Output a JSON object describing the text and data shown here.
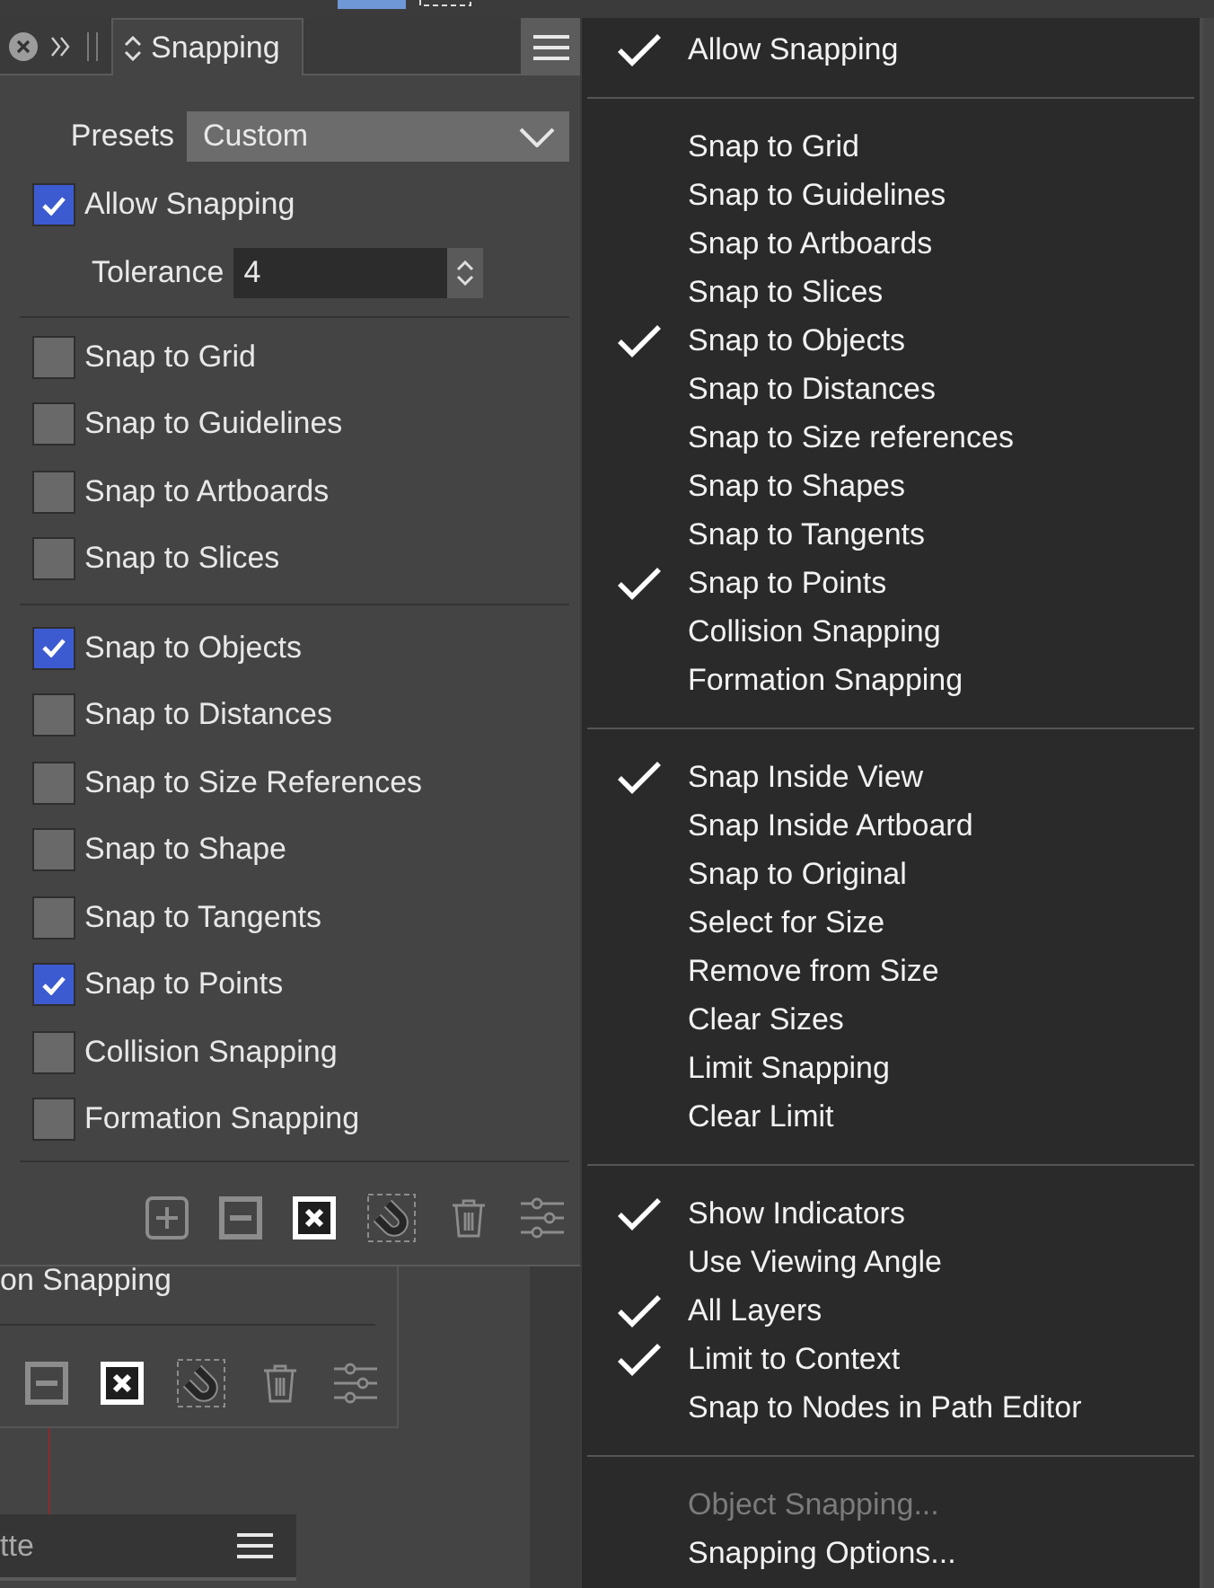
{
  "panel": {
    "tabs": [
      {
        "label": "Snapping",
        "selected": true
      }
    ],
    "presets": {
      "label": "Presets",
      "value": "Custom"
    },
    "allow_snapping": {
      "label": "Allow Snapping",
      "checked": true
    },
    "tolerance": {
      "label": "Tolerance",
      "value": "4"
    },
    "option_groups": [
      {
        "options": [
          {
            "label": "Snap to Grid",
            "checked": false
          },
          {
            "label": "Snap to Guidelines",
            "checked": false
          },
          {
            "label": "Snap to Artboards",
            "checked": false
          },
          {
            "label": "Snap to Slices",
            "checked": false
          }
        ]
      },
      {
        "options": [
          {
            "label": "Snap to Objects",
            "checked": true
          },
          {
            "label": "Snap to Distances",
            "checked": false
          },
          {
            "label": "Snap to Size References",
            "checked": false
          },
          {
            "label": "Snap to Shape",
            "checked": false
          },
          {
            "label": "Snap to Tangents",
            "checked": false
          },
          {
            "label": "Snap to Points",
            "checked": true
          },
          {
            "label": "Collision Snapping",
            "checked": false
          },
          {
            "label": "Formation Snapping",
            "checked": false
          }
        ]
      }
    ]
  },
  "background_panels": [
    {
      "kind": "toolbar",
      "title": "on Snapping"
    },
    {
      "kind": "header",
      "title": "tte"
    }
  ],
  "menu": {
    "sections": [
      {
        "items": [
          {
            "label": "Allow Snapping",
            "checked": true
          }
        ]
      },
      {
        "items": [
          {
            "label": "Snap to Grid",
            "checked": false
          },
          {
            "label": "Snap to Guidelines",
            "checked": false
          },
          {
            "label": "Snap to Artboards",
            "checked": false
          },
          {
            "label": "Snap to Slices",
            "checked": false
          },
          {
            "label": "Snap to Objects",
            "checked": true
          },
          {
            "label": "Snap to Distances",
            "checked": false
          },
          {
            "label": "Snap to Size references",
            "checked": false
          },
          {
            "label": "Snap to Shapes",
            "checked": false
          },
          {
            "label": "Snap to Tangents",
            "checked": false
          },
          {
            "label": "Snap to Points",
            "checked": true
          },
          {
            "label": "Collision Snapping",
            "checked": false
          },
          {
            "label": "Formation Snapping",
            "checked": false
          }
        ]
      },
      {
        "items": [
          {
            "label": "Snap Inside View",
            "checked": true
          },
          {
            "label": "Snap Inside Artboard",
            "checked": false
          },
          {
            "label": "Snap to Original",
            "checked": false
          },
          {
            "label": "Select for Size",
            "checked": false
          },
          {
            "label": "Remove from Size",
            "checked": false
          },
          {
            "label": "Clear Sizes",
            "checked": false
          },
          {
            "label": "Limit Snapping",
            "checked": false
          },
          {
            "label": "Clear Limit",
            "checked": false
          }
        ]
      },
      {
        "items": [
          {
            "label": "Show Indicators",
            "checked": true
          },
          {
            "label": "Use Viewing Angle",
            "checked": false
          },
          {
            "label": "All Layers",
            "checked": true
          },
          {
            "label": "Limit to Context",
            "checked": true
          },
          {
            "label": "Snap to Nodes in Path Editor",
            "checked": false
          }
        ]
      },
      {
        "items": [
          {
            "label": "Object Snapping...",
            "checked": false,
            "disabled": true
          },
          {
            "label": "Snapping Options...",
            "checked": false,
            "disabled": false
          }
        ]
      }
    ]
  }
}
